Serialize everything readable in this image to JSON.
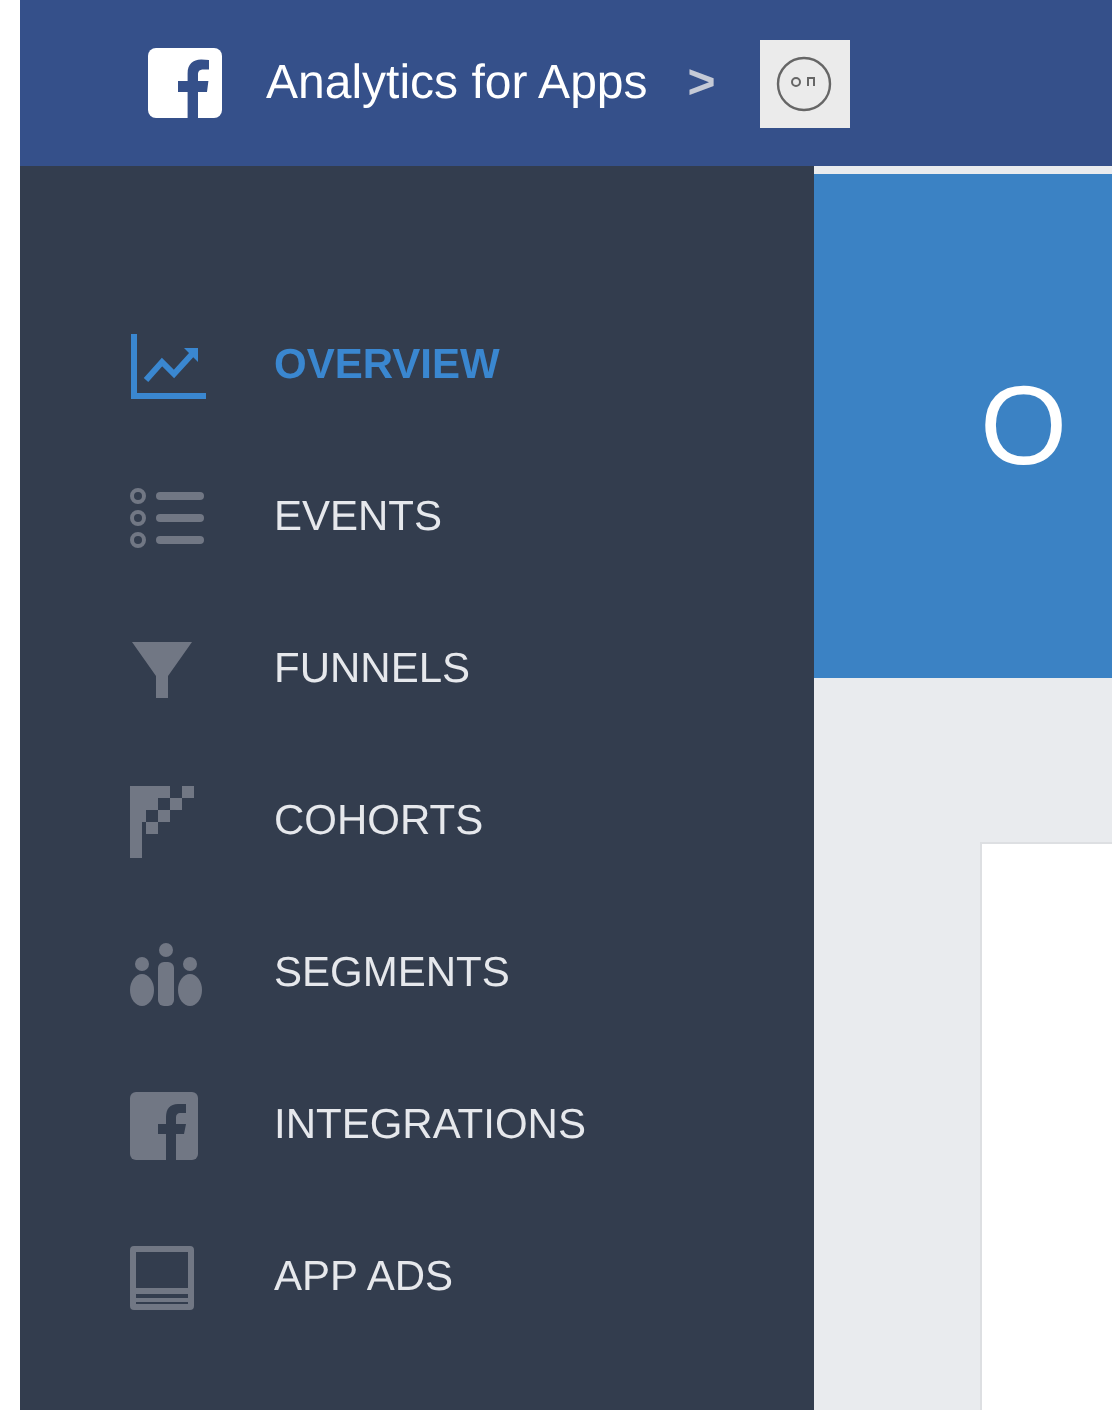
{
  "top_bar": {
    "title": "Analytics for Apps",
    "separator": ">"
  },
  "sidebar": {
    "items": [
      {
        "kind": "overview",
        "label": "OVERVIEW",
        "selected": true
      },
      {
        "kind": "events",
        "label": "EVENTS",
        "selected": false
      },
      {
        "kind": "funnels",
        "label": "FUNNELS",
        "selected": false
      },
      {
        "kind": "cohorts",
        "label": "COHORTS",
        "selected": false
      },
      {
        "kind": "segments",
        "label": "SEGMENTS",
        "selected": false
      },
      {
        "kind": "integrations",
        "label": "INTEGRATIONS",
        "selected": false
      },
      {
        "kind": "app_ads",
        "label": "APP ADS",
        "selected": false
      }
    ]
  },
  "main": {
    "heading": "O"
  }
}
